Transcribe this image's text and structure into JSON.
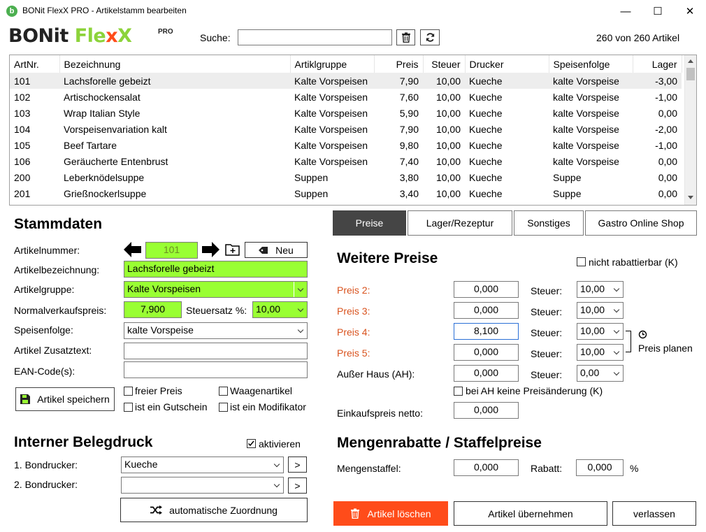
{
  "window": {
    "title": "BONit FlexX PRO - Artikelstamm bearbeiten",
    "minimize": "—",
    "maximize": "☐",
    "close": "✕"
  },
  "logo": {
    "part1": "BONit ",
    "part2": "Fle",
    "part3": "x",
    "part4": "X",
    "pro": "PRO"
  },
  "search": {
    "label": "Suche:",
    "value": "",
    "count": "260 von 260 Artikel"
  },
  "grid": {
    "columns": [
      "ArtNr.",
      "Bezeichnung",
      "Artiklgruppe",
      "Preis",
      "Steuer",
      "Drucker",
      "Speisenfolge",
      "Lager"
    ],
    "rows": [
      [
        "101",
        "Lachsforelle gebeizt",
        "Kalte Vorspeisen",
        "7,90",
        "10,00",
        "Kueche",
        "kalte Vorspeise",
        "-3,00"
      ],
      [
        "102",
        "Artischockensalat",
        "Kalte Vorspeisen",
        "7,60",
        "10,00",
        "Kueche",
        "kalte Vorspeise",
        "-1,00"
      ],
      [
        "103",
        "Wrap Italian Style",
        "Kalte Vorspeisen",
        "5,90",
        "10,00",
        "Kueche",
        "kalte Vorspeise",
        "0,00"
      ],
      [
        "104",
        "Vorspeisenvariation kalt",
        "Kalte Vorspeisen",
        "7,90",
        "10,00",
        "Kueche",
        "kalte Vorspeise",
        "-2,00"
      ],
      [
        "105",
        "Beef Tartare",
        "Kalte Vorspeisen",
        "9,80",
        "10,00",
        "Kueche",
        "kalte Vorspeise",
        "-1,00"
      ],
      [
        "106",
        "Geräucherte Entenbrust",
        "Kalte Vorspeisen",
        "7,40",
        "10,00",
        "Kueche",
        "kalte Vorspeise",
        "0,00"
      ],
      [
        "200",
        "Leberknödelsuppe",
        "Suppen",
        "3,80",
        "10,00",
        "Kueche",
        "Suppe",
        "0,00"
      ],
      [
        "201",
        "Grießnockerlsuppe",
        "Suppen",
        "3,40",
        "10,00",
        "Kueche",
        "Suppe",
        "0,00"
      ]
    ]
  },
  "stammdaten": {
    "title": "Stammdaten",
    "artnr_label": "Artikelnummer:",
    "artnr": "101",
    "neu": "Neu",
    "bez_label": "Artikelbezeichnung:",
    "bez": "Lachsforelle gebeizt",
    "gruppe_label": "Artikelgruppe:",
    "gruppe": "Kalte Vorspeisen",
    "preis_label": "Normalverkaufspreis:",
    "preis": "7,900",
    "steuer_label": "Steuersatz %:",
    "steuer": "10,00",
    "folge_label": "Speisenfolge:",
    "folge": "kalte Vorspeise",
    "zusatz_label": "Artikel Zusatztext:",
    "zusatz": "",
    "ean_label": "EAN-Code(s):",
    "ean": "",
    "save": "Artikel speichern",
    "cb_freier": "freier Preis",
    "cb_waage": "Waagenartikel",
    "cb_gutschein": "ist ein Gutschein",
    "cb_modifikator": "ist ein Modifikator"
  },
  "beleg": {
    "title": "Interner Belegdruck",
    "aktivieren": "aktivieren",
    "bon1_label": "1. Bondrucker:",
    "bon1": "Kueche",
    "bon2_label": "2. Bondrucker:",
    "bon2": "",
    "more": ">",
    "auto": "automatische Zuordnung"
  },
  "tabs": [
    "Preise",
    "Lager/Rezeptur",
    "Sonstiges",
    "Gastro Online Shop"
  ],
  "preise": {
    "title": "Weitere Preise",
    "nicht_rabatt": "nicht rabattierbar (K)",
    "steuer_label": "Steuer:",
    "rows": [
      {
        "label": "Preis 2:",
        "value": "0,000",
        "steuer": "10,00"
      },
      {
        "label": "Preis 3:",
        "value": "0,000",
        "steuer": "10,00"
      },
      {
        "label": "Preis 4:",
        "value": "8,100",
        "steuer": "10,00"
      },
      {
        "label": "Preis 5:",
        "value": "0,000",
        "steuer": "10,00"
      },
      {
        "label": "Außer Haus (AH):",
        "value": "0,000",
        "steuer": "0,00"
      }
    ],
    "planen": "Preis planen",
    "ah_keine": "bei AH keine Preisänderung (K)",
    "ek_label": "Einkaufspreis netto:",
    "ek": "0,000"
  },
  "mengen": {
    "title": "Mengenrabatte / Staffelpreise",
    "staffel_label": "Mengenstaffel:",
    "staffel": "0,000",
    "rabatt_label": "Rabatt:",
    "rabatt": "0,000",
    "percent": "%"
  },
  "footer": {
    "delete": "Artikel löschen",
    "apply": "Artikel übernehmen",
    "leave": "verlassen"
  },
  "colors": {
    "accent_green": "#99ff33",
    "delete_orange": "#ff4c1a",
    "active_tab": "#454545",
    "price_label_red": "#d9531e"
  }
}
